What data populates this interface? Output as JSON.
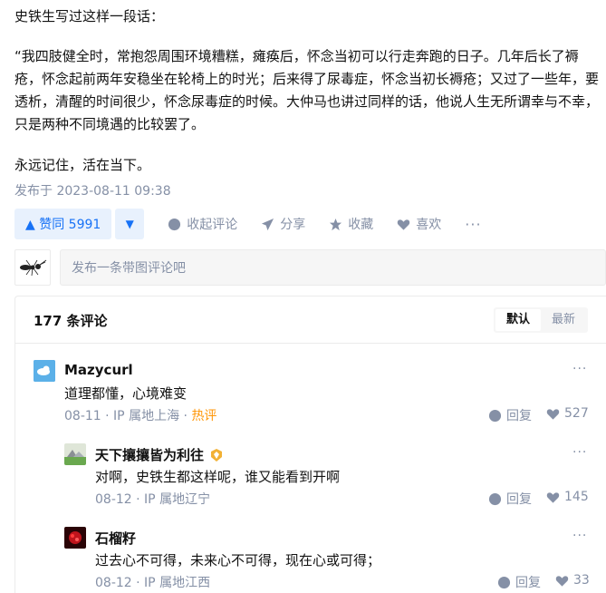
{
  "answer": {
    "intro": "史铁生写过这样一段话：",
    "quote": "“我四肢健全时，常抱怨周围环境糟糕，瘫痪后，怀念当初可以行走奔跑的日子。几年后长了褥疮，怀念起前两年安稳坐在轮椅上的时光；后来得了尿毒症，怀念当初长褥疮；又过了一些年，要透析，清醒的时间很少，怀念尿毒症的时候。大仲马也讲过同样的话，他说人生无所谓幸与不幸，只是两种不同境遇的比较罢了。",
    "closing": "永远记住，活在当下。",
    "published": "发布于 2023-08-11 09:38"
  },
  "actions": {
    "upvote_label": "▲ 赞同 5991",
    "downvote_label": "▼",
    "comment_label": "收起评论",
    "share_label": "分享",
    "collect_label": "收藏",
    "like_label": "喜欢",
    "more_label": "···"
  },
  "composer": {
    "placeholder": "发布一条带图评论吧"
  },
  "comments": {
    "count_label": "177 条评论",
    "sort": [
      "默认",
      "最新"
    ],
    "items": [
      {
        "name": "Mazycurl",
        "text": "道理都懂，心境难变",
        "date": "08-11",
        "ip": "IP 属地上海",
        "tag": "热评",
        "reply_label": "回复",
        "likes": "527"
      },
      {
        "name": "天下攘攘皆为利往",
        "text": "对啊，史铁生都这样呢，谁又能看到开啊",
        "date": "08-12",
        "ip": "IP 属地辽宁",
        "reply_label": "回复",
        "likes": "145"
      },
      {
        "name": "石榴籽",
        "text": "过去心不可得，未来心不可得，现在心或可得；",
        "date": "08-12",
        "ip": "IP 属地江西",
        "reply_label": "回复",
        "likes": "33"
      }
    ],
    "more_label": "···",
    "dot_separator": "·"
  },
  "colors": {
    "accent": "#1772f6",
    "accent_bg": "#e8f1fd",
    "muted": "#8590a6",
    "hot": "#ff9607"
  }
}
